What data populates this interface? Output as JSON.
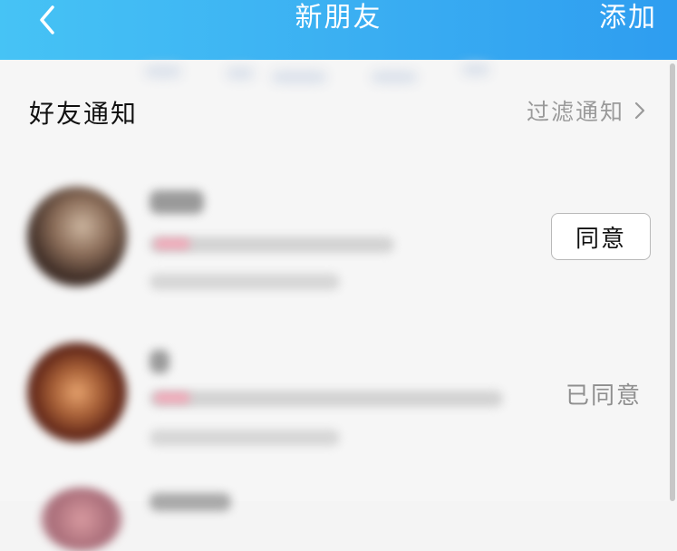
{
  "header": {
    "title": "新朋友",
    "add_label": "添加",
    "back_icon": "chevron-left-icon",
    "background_colors": [
      "#46c3f5",
      "#2e9df0"
    ]
  },
  "friend_notifications": {
    "title": "好友通知",
    "filter_label": "过滤通知",
    "filter_icon": "chevron-right-icon"
  },
  "requests": [
    {
      "action_label": "同意"
    },
    {
      "status_label": "已同意"
    }
  ]
}
